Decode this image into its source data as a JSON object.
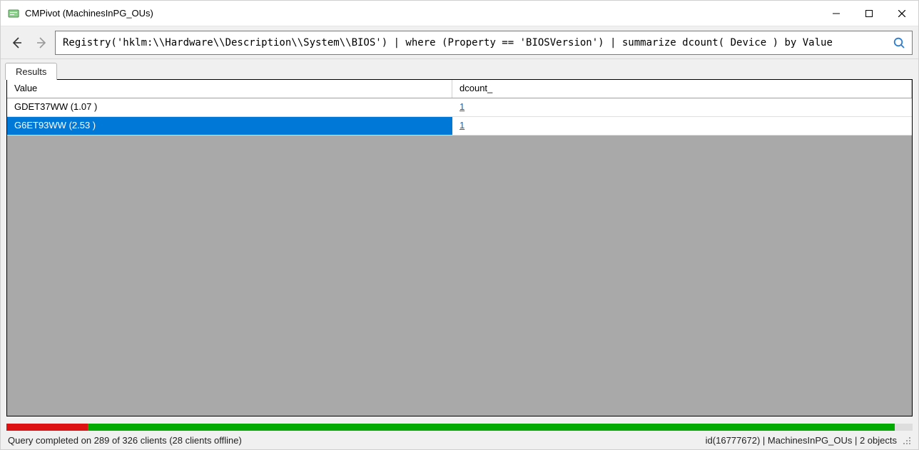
{
  "window": {
    "title": "CMPivot (MachinesInPG_OUs)"
  },
  "query": {
    "text": "Registry('hklm:\\\\Hardware\\\\Description\\\\System\\\\BIOS') | where (Property == 'BIOSVersion') | summarize dcount( Device ) by Value"
  },
  "tabs": {
    "results_label": "Results"
  },
  "table": {
    "columns": {
      "value": "Value",
      "dcount": "dcount_"
    },
    "rows": [
      {
        "value": "GDET37WW (1.07 )",
        "dcount": "1",
        "selected": false
      },
      {
        "value": "G6ET93WW (2.53 )",
        "dcount": "1",
        "selected": true
      }
    ]
  },
  "progress": {
    "red_pct": 9,
    "green_pct": 89,
    "gray_pct": 2
  },
  "status": {
    "left": "Query completed on 289 of 326 clients (28 clients offline)",
    "right": "id(16777672)  |  MachinesInPG_OUs  |  2 objects"
  }
}
